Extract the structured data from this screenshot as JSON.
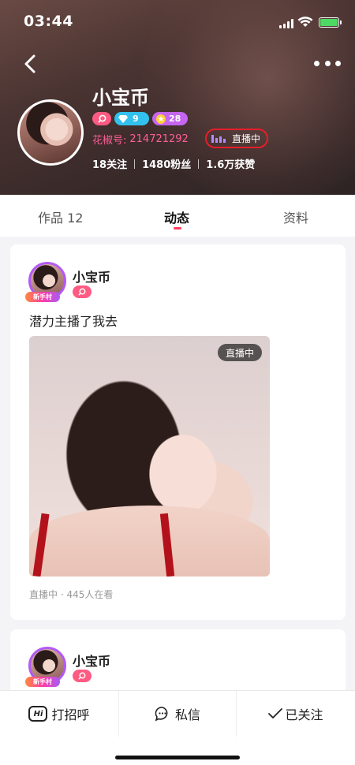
{
  "status_bar": {
    "time": "03:44"
  },
  "profile": {
    "name": "小宝币",
    "badges": {
      "diamond": "9",
      "star": "28"
    },
    "id_label": "花椒号:",
    "id_value": "214721292",
    "live_status": "直播中",
    "stats": {
      "following": "18关注",
      "fans": "1480粉丝",
      "likes": "1.6万获赞"
    }
  },
  "tabs": {
    "works": "作品 12",
    "moments": "动态",
    "info": "资料"
  },
  "post": {
    "name": "小宝币",
    "newbie_tag": "新手村",
    "text": "潜力主播了我去",
    "live_chip": "直播中",
    "meta": "直播中 · 445人在看"
  },
  "post2": {
    "name": "小宝币",
    "newbie_tag": "新手村"
  },
  "bottom_bar": {
    "greet": "打招呼",
    "message": "私信",
    "followed": "已关注",
    "hi_icon_text": "Hi"
  },
  "colors": {
    "accent": "#ff3b5c",
    "live_circle": "#e61e2a",
    "id_pink": "#ff5e98",
    "battery_green": "#4cd964"
  }
}
